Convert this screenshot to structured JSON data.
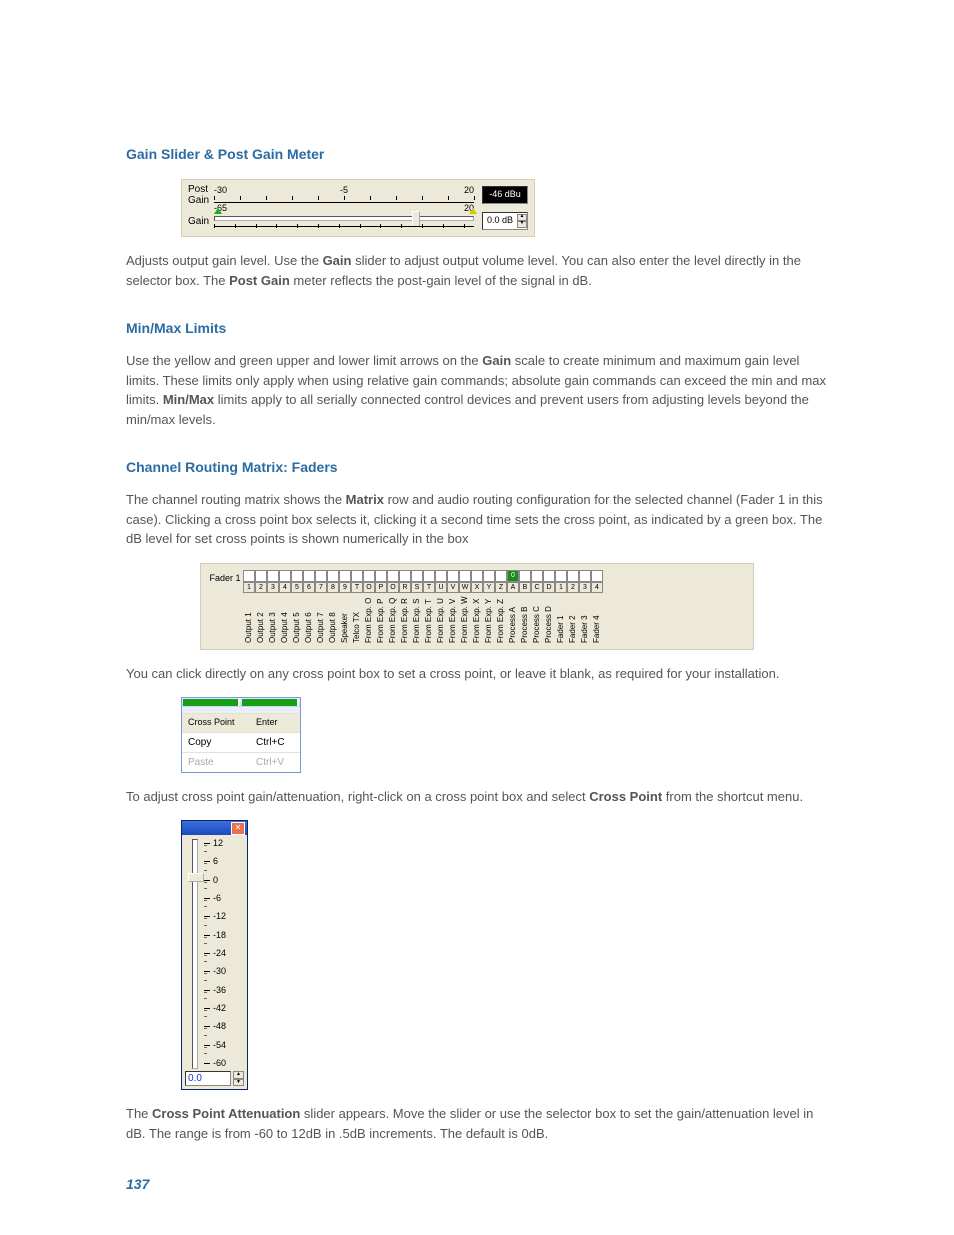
{
  "headings": {
    "gain": "Gain Slider & Post Gain Meter",
    "minmax": "Min/Max Limits",
    "faders": "Channel Routing Matrix: Faders"
  },
  "p1a": "Adjusts output gain level. Use the ",
  "p1b": "Gain",
  "p1c": " slider to adjust output volume level. You can also enter the level directly in the selector box. The ",
  "p1d": "Post Gain",
  "p1e": " meter reflects the post-gain level of the signal in dB.",
  "p2a": "Use the yellow and green upper and lower limit arrows on the ",
  "p2b": "Gain",
  "p2c": " scale to create minimum and maximum gain level limits. These limits only apply when using relative gain commands; absolute gain commands can exceed the min and max limits. ",
  "p2d": "Min/Max",
  "p2e": " limits apply to all serially connected control devices and prevent users from adjusting levels beyond the min/max levels.",
  "p3a": "The channel routing matrix shows the ",
  "p3b": "Matrix",
  "p3c": " row and audio routing configuration for the selected channel (Fader 1 in this case). Clicking a cross point box selects it, clicking it a second time sets the cross point, as indicated by a green box. The dB level for set cross points is shown numerically in the box",
  "p4": "You can click directly on any cross point box to set a cross point, or leave it blank, as required for your installation.",
  "p5a": "To adjust cross point gain/attenuation, right-click on a cross point box and select ",
  "p5b": "Cross Point",
  "p5c": " from the shortcut menu.",
  "p6a": "The ",
  "p6b": "Cross Point Attenuation",
  "p6c": " slider appears. Move the slider or use the selector box to set the gain/attenuation level in dB. The range is from -60 to 12dB in .5dB increments. The default is 0dB.",
  "page_number": "137",
  "gain_figure": {
    "post_label": "Post Gain",
    "gain_label": "Gain",
    "scale_min": "-30",
    "scale_mid": "-5",
    "scale_max": "20",
    "gain_scale_min": "-65",
    "gain_scale_max": "20",
    "meter_value": "-46 dBu",
    "gain_value": "0.0 dB"
  },
  "matrix_figure": {
    "row_label": "Fader 1",
    "headers": [
      "1",
      "2",
      "3",
      "4",
      "5",
      "6",
      "7",
      "8",
      "9",
      "T",
      "O",
      "P",
      "O",
      "R",
      "S",
      "T",
      "U",
      "V",
      "W",
      "X",
      "Y",
      "Z",
      "A",
      "B",
      "C",
      "D",
      "1",
      "2",
      "3",
      "4"
    ],
    "labels": [
      "Output 1",
      "Output 2",
      "Output 3",
      "Output 4",
      "Output 5",
      "Output 6",
      "Output 7",
      "Output 8",
      "Speaker",
      "Telco TX",
      "From Exp. O",
      "From Exp. P",
      "From Exp. Q",
      "From Exp. R",
      "From Exp. S",
      "From Exp. T",
      "From Exp. U",
      "From Exp. V",
      "From Exp. W",
      "From Exp. X",
      "From Exp. Y",
      "From Exp. Z",
      "Process A",
      "Process B",
      "Process C",
      "Process D",
      "Fader 1",
      "Fader 2",
      "Fader 3",
      "Fader 4"
    ],
    "set_index": 22,
    "set_value": "0"
  },
  "context_menu": {
    "header_col1": "Cross Point",
    "header_col2": "Enter",
    "item1": "Copy",
    "item1_sc": "Ctrl+C",
    "item2": "Paste",
    "item2_sc": "Ctrl+V"
  },
  "cpa_slider": {
    "ticks": [
      "12",
      "6",
      "0",
      "-6",
      "-12",
      "-18",
      "-24",
      "-30",
      "-36",
      "-42",
      "-48",
      "-54",
      "-60"
    ],
    "value": "0.0"
  }
}
